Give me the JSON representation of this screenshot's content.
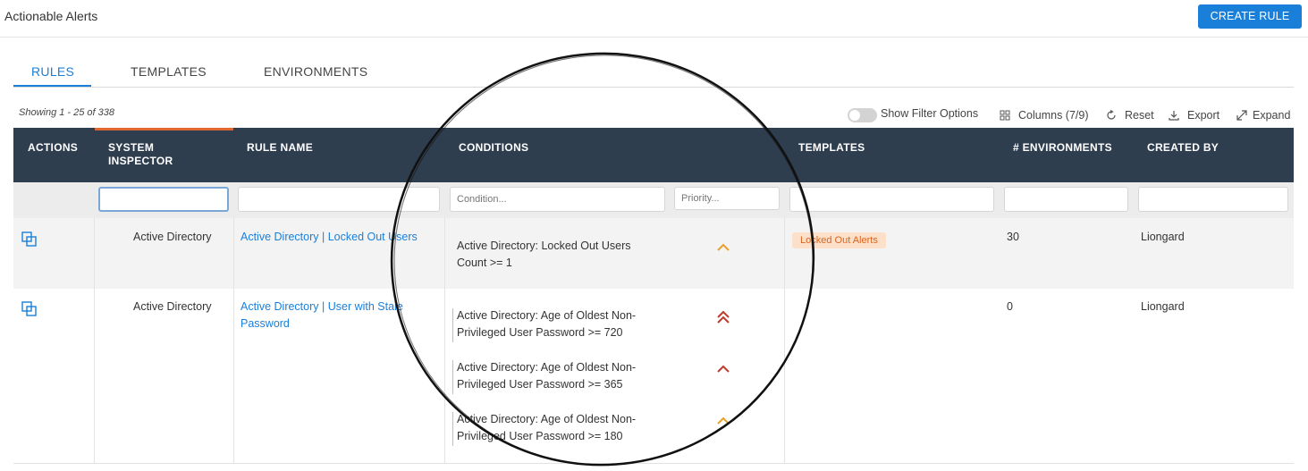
{
  "app": {
    "title": "Actionable Alerts",
    "create_rule_label": "CREATE RULE"
  },
  "tabs": [
    {
      "label": "RULES",
      "active": true
    },
    {
      "label": "TEMPLATES"
    },
    {
      "label": "ENVIRONMENTS"
    }
  ],
  "summary": {
    "showing": "Showing 1 - 25 of 338"
  },
  "toolbar": {
    "show_filter": "Show Filter Options",
    "columns": "Columns (7/9)",
    "reset": "Reset",
    "export": "Export",
    "expand": "Expand"
  },
  "columns": {
    "actions": "ACTIONS",
    "system_inspector": "SYSTEM INSPECTOR",
    "rule_name": "RULE NAME",
    "conditions": "CONDITIONS",
    "templates": "TEMPLATES",
    "environments": "# ENVIRONMENTS",
    "created_by": "CREATED BY"
  },
  "filters": {
    "condition_placeholder": "Condition...",
    "priority_placeholder": "Priority..."
  },
  "colors": {
    "accent": "#1a7fd9",
    "header_bg": "#2f3e4f",
    "priority_medium": "#e8a028",
    "priority_high": "#c0392b",
    "badge_bg": "#fde0c9",
    "badge_text": "#d9641e"
  },
  "rows": [
    {
      "system_inspector": "Active Directory",
      "rule_name": "Active Directory | Locked Out Users",
      "conditions": [
        {
          "text": "Active Directory: Locked Out Users Count >= 1",
          "priority_icon": "chevron-up-icon"
        }
      ],
      "template": "Locked Out Alerts",
      "environments": "30",
      "created_by": "Liongard"
    },
    {
      "system_inspector": "Active Directory",
      "rule_name": "Active Directory | User with Stale Password",
      "conditions": [
        {
          "text": "Active Directory: Age of Oldest Non-Privileged User Password >= 720",
          "priority_icon": "double-chevron-up-icon"
        },
        {
          "text": "Active Directory: Age of Oldest Non-Privileged User Password >= 365",
          "priority_icon": "chevron-up-icon"
        },
        {
          "text": "Active Directory: Age of Oldest Non-Privileged User Password >= 180",
          "priority_icon": "chevron-up-icon"
        }
      ],
      "template": "",
      "environments": "0",
      "created_by": "Liongard"
    }
  ]
}
